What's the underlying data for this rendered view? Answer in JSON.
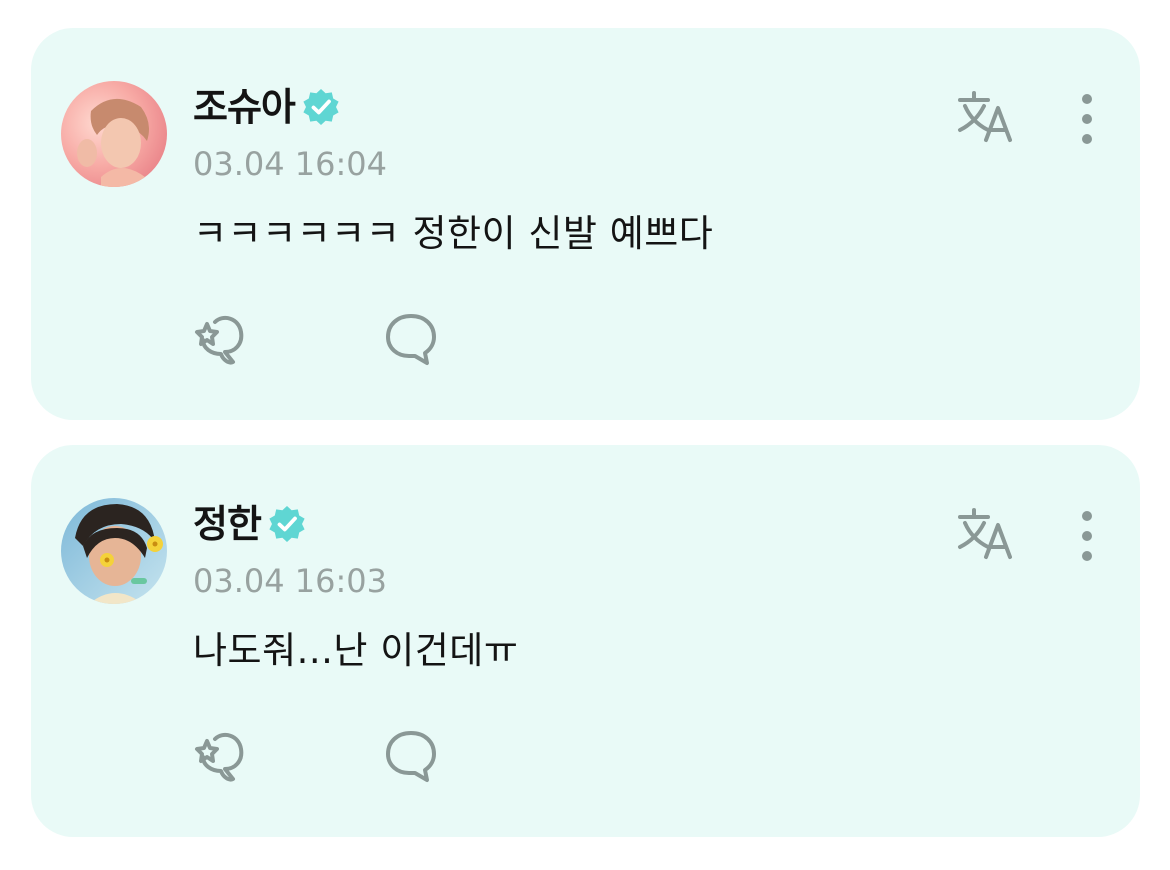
{
  "posts": [
    {
      "author": "조슈아",
      "verified": true,
      "timestamp": "03.04 16:04",
      "message": "ㅋㅋㅋㅋㅋㅋ 정한이 신발 예쁘다",
      "avatar_icon": "avatar-photo",
      "actions": [
        "react-icon",
        "comment-icon",
        "translate-icon",
        "more-icon"
      ]
    },
    {
      "author": "정한",
      "verified": true,
      "timestamp": "03.04 16:03",
      "message": "나도줘...난 이건데ㅠ",
      "avatar_icon": "avatar-photo",
      "actions": [
        "react-icon",
        "comment-icon",
        "translate-icon",
        "more-icon"
      ]
    }
  ],
  "colors": {
    "card_background": "#e9faf7",
    "verified_badge": "#5fd6d3",
    "icon_gray": "#8a9896",
    "timestamp_gray": "#98a2a0",
    "text": "#141414"
  }
}
